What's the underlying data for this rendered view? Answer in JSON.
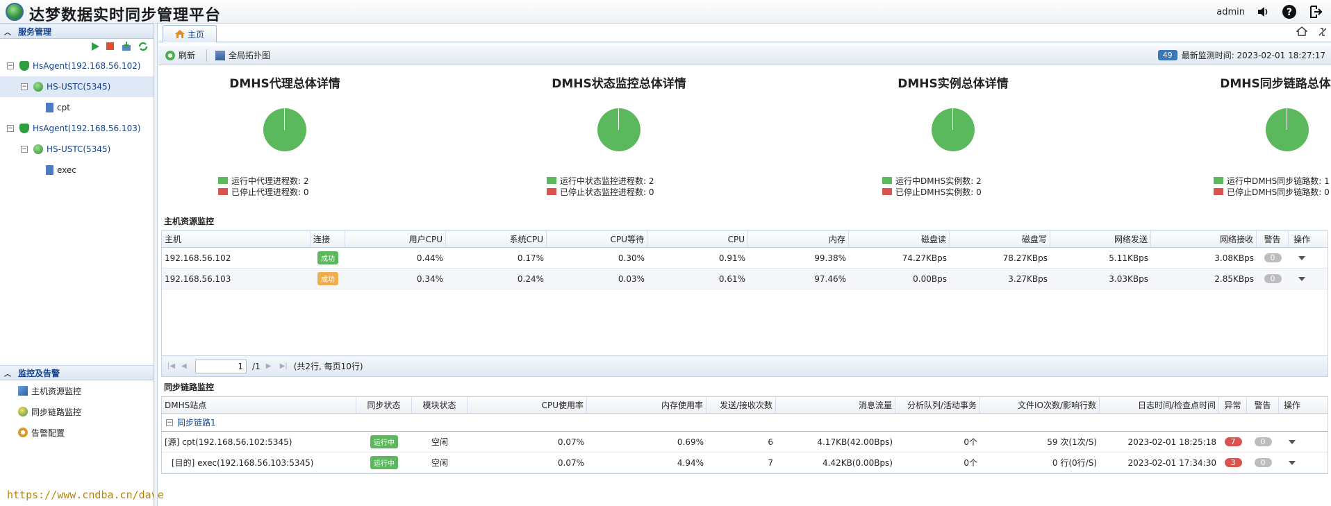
{
  "app": {
    "title": "达梦数据实时同步管理平台",
    "user": "admin"
  },
  "sidebar": {
    "service_panel": "服务管理",
    "tree": [
      {
        "label": "HsAgent(192.168.56.102)"
      },
      {
        "label": "HS-USTC(5345)"
      },
      {
        "label": "cpt"
      },
      {
        "label": "HsAgent(192.168.56.103)"
      },
      {
        "label": "HS-USTC(5345)"
      },
      {
        "label": "exec"
      }
    ],
    "monitor_panel": "监控及告警",
    "menu": [
      {
        "label": "主机资源监控"
      },
      {
        "label": "同步链路监控"
      },
      {
        "label": "告警配置"
      }
    ]
  },
  "watermark": "https://www.cndba.cn/dave",
  "tabs": [
    {
      "label": "主页"
    }
  ],
  "toolbar": {
    "refresh": "刷新",
    "topology": "全局拓扑图",
    "count": "49",
    "last_monitor": "最新监测时间: 2023-02-01 18:27:17"
  },
  "summary": [
    {
      "title": "DMHS代理总体详情",
      "running": "运行中代理进程数: 2",
      "stopped": "已停止代理进程数: 0"
    },
    {
      "title": "DMHS状态监控总体详情",
      "running": "运行中状态监控进程数: 2",
      "stopped": "已停止状态监控进程数: 0"
    },
    {
      "title": "DMHS实例总体详情",
      "running": "运行中DMHS实例数: 2",
      "stopped": "已停止DMHS实例数: 0"
    },
    {
      "title": "DMHS同步链路总体详情",
      "running": "运行中DMHS同步链路数: 1",
      "stopped": "已停止DMHS同步链路数: 0"
    }
  ],
  "host_section": {
    "title": "主机资源监控",
    "columns": [
      "主机",
      "连接",
      "用户CPU",
      "系统CPU",
      "CPU等待",
      "CPU",
      "内存",
      "磁盘读",
      "磁盘写",
      "网络发送",
      "网络接收",
      "警告",
      "操作"
    ],
    "rows": [
      [
        "192.168.56.102",
        "成功",
        "0.44%",
        "0.17%",
        "0.30%",
        "0.91%",
        "99.38%",
        "74.27KBps",
        "78.27KBps",
        "5.11KBps",
        "3.08KBps",
        "0"
      ],
      [
        "192.168.56.103",
        "成功",
        "0.34%",
        "0.24%",
        "0.03%",
        "0.61%",
        "97.46%",
        "0.00Bps",
        "3.27KBps",
        "3.03KBps",
        "2.85KBps",
        "0"
      ]
    ],
    "pager": {
      "page": "1",
      "total": "/1",
      "info": "(共2行, 每页10行)"
    }
  },
  "link_section": {
    "title": "同步链路监控",
    "columns": [
      "DMHS站点",
      "同步状态",
      "模块状态",
      "CPU使用率",
      "内存使用率",
      "发送/接收次数",
      "消息流量",
      "分析队列/活动事务",
      "文件IO次数/影响行数",
      "日志时间/检查点时间",
      "异常",
      "警告",
      "操作"
    ],
    "group": "同步链路1",
    "rows": [
      [
        "[源] cpt(192.168.56.102:5345)",
        "运行中",
        "空闲",
        "0.07%",
        "0.69%",
        "6",
        "4.17KB(42.00Bps)",
        "0个",
        "59 次(1次/S)",
        "2023-02-01 18:25:18",
        "7",
        "0"
      ],
      [
        "[目的] exec(192.168.56.103:5345)",
        "运行中",
        "空闲",
        "0.07%",
        "4.94%",
        "7",
        "4.42KB(0.00Bps)",
        "0个",
        "0 行(0行/S)",
        "2023-02-01 17:34:30",
        "3",
        "0"
      ]
    ]
  }
}
